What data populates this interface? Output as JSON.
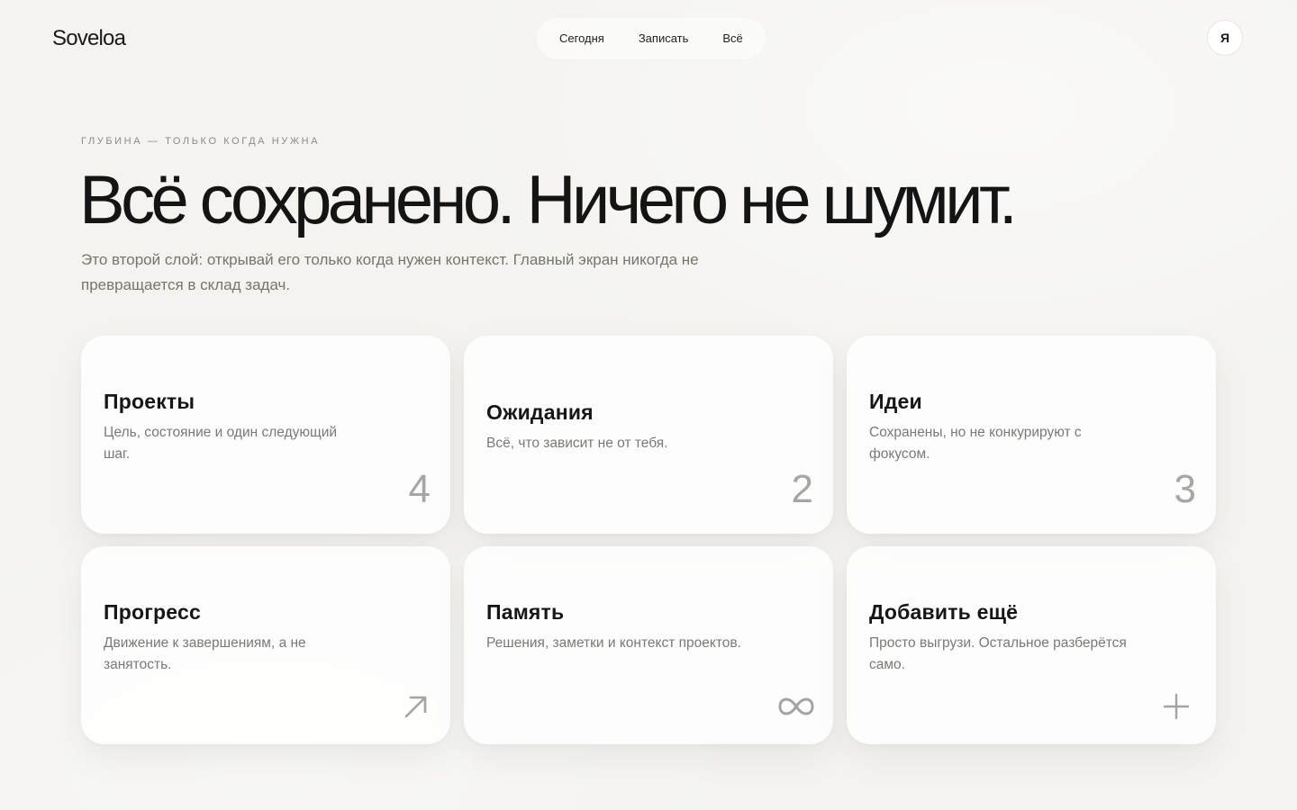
{
  "app": {
    "logo": "Soveloa"
  },
  "nav": {
    "items": [
      {
        "label": "Сегодня",
        "active": false
      },
      {
        "label": "Записать",
        "active": false
      },
      {
        "label": "Всё",
        "active": true
      }
    ]
  },
  "user": {
    "avatar_letter": "Я"
  },
  "hero": {
    "eyebrow": "ГЛУБИНА — ТОЛЬКО КОГДА НУЖНА",
    "headline": "Всё сохранено. Ничего не шумит.",
    "lead": "Это второй слой: открывай его только когда нужен контекст. Главный экран никогда не превращается в склад задач."
  },
  "cards": [
    {
      "title": "Проекты",
      "description": "Цель, состояние и один следующий шаг.",
      "count": "4"
    },
    {
      "title": "Ожидания",
      "description": "Всё, что зависит не от тебя.",
      "count": "2"
    },
    {
      "title": "Идеи",
      "description": "Сохранены, но не конкурируют с фокусом.",
      "count": "3"
    },
    {
      "title": "Прогресс",
      "description": "Движение к завершениям, а не занятость.",
      "icon": "arrow-up-right-icon"
    },
    {
      "title": "Память",
      "description": "Решения, заметки и контекст проектов.",
      "icon": "infinity-icon"
    },
    {
      "title": "Добавить ещё",
      "description": "Просто выгрузи. Остальное разберётся само.",
      "icon": "plus-icon"
    }
  ],
  "colors": {
    "background": "#f4f3f0",
    "card": "#ffffff",
    "text": "#161616",
    "muted": "#7a7975",
    "accent_gray": "#a7a6a3"
  }
}
